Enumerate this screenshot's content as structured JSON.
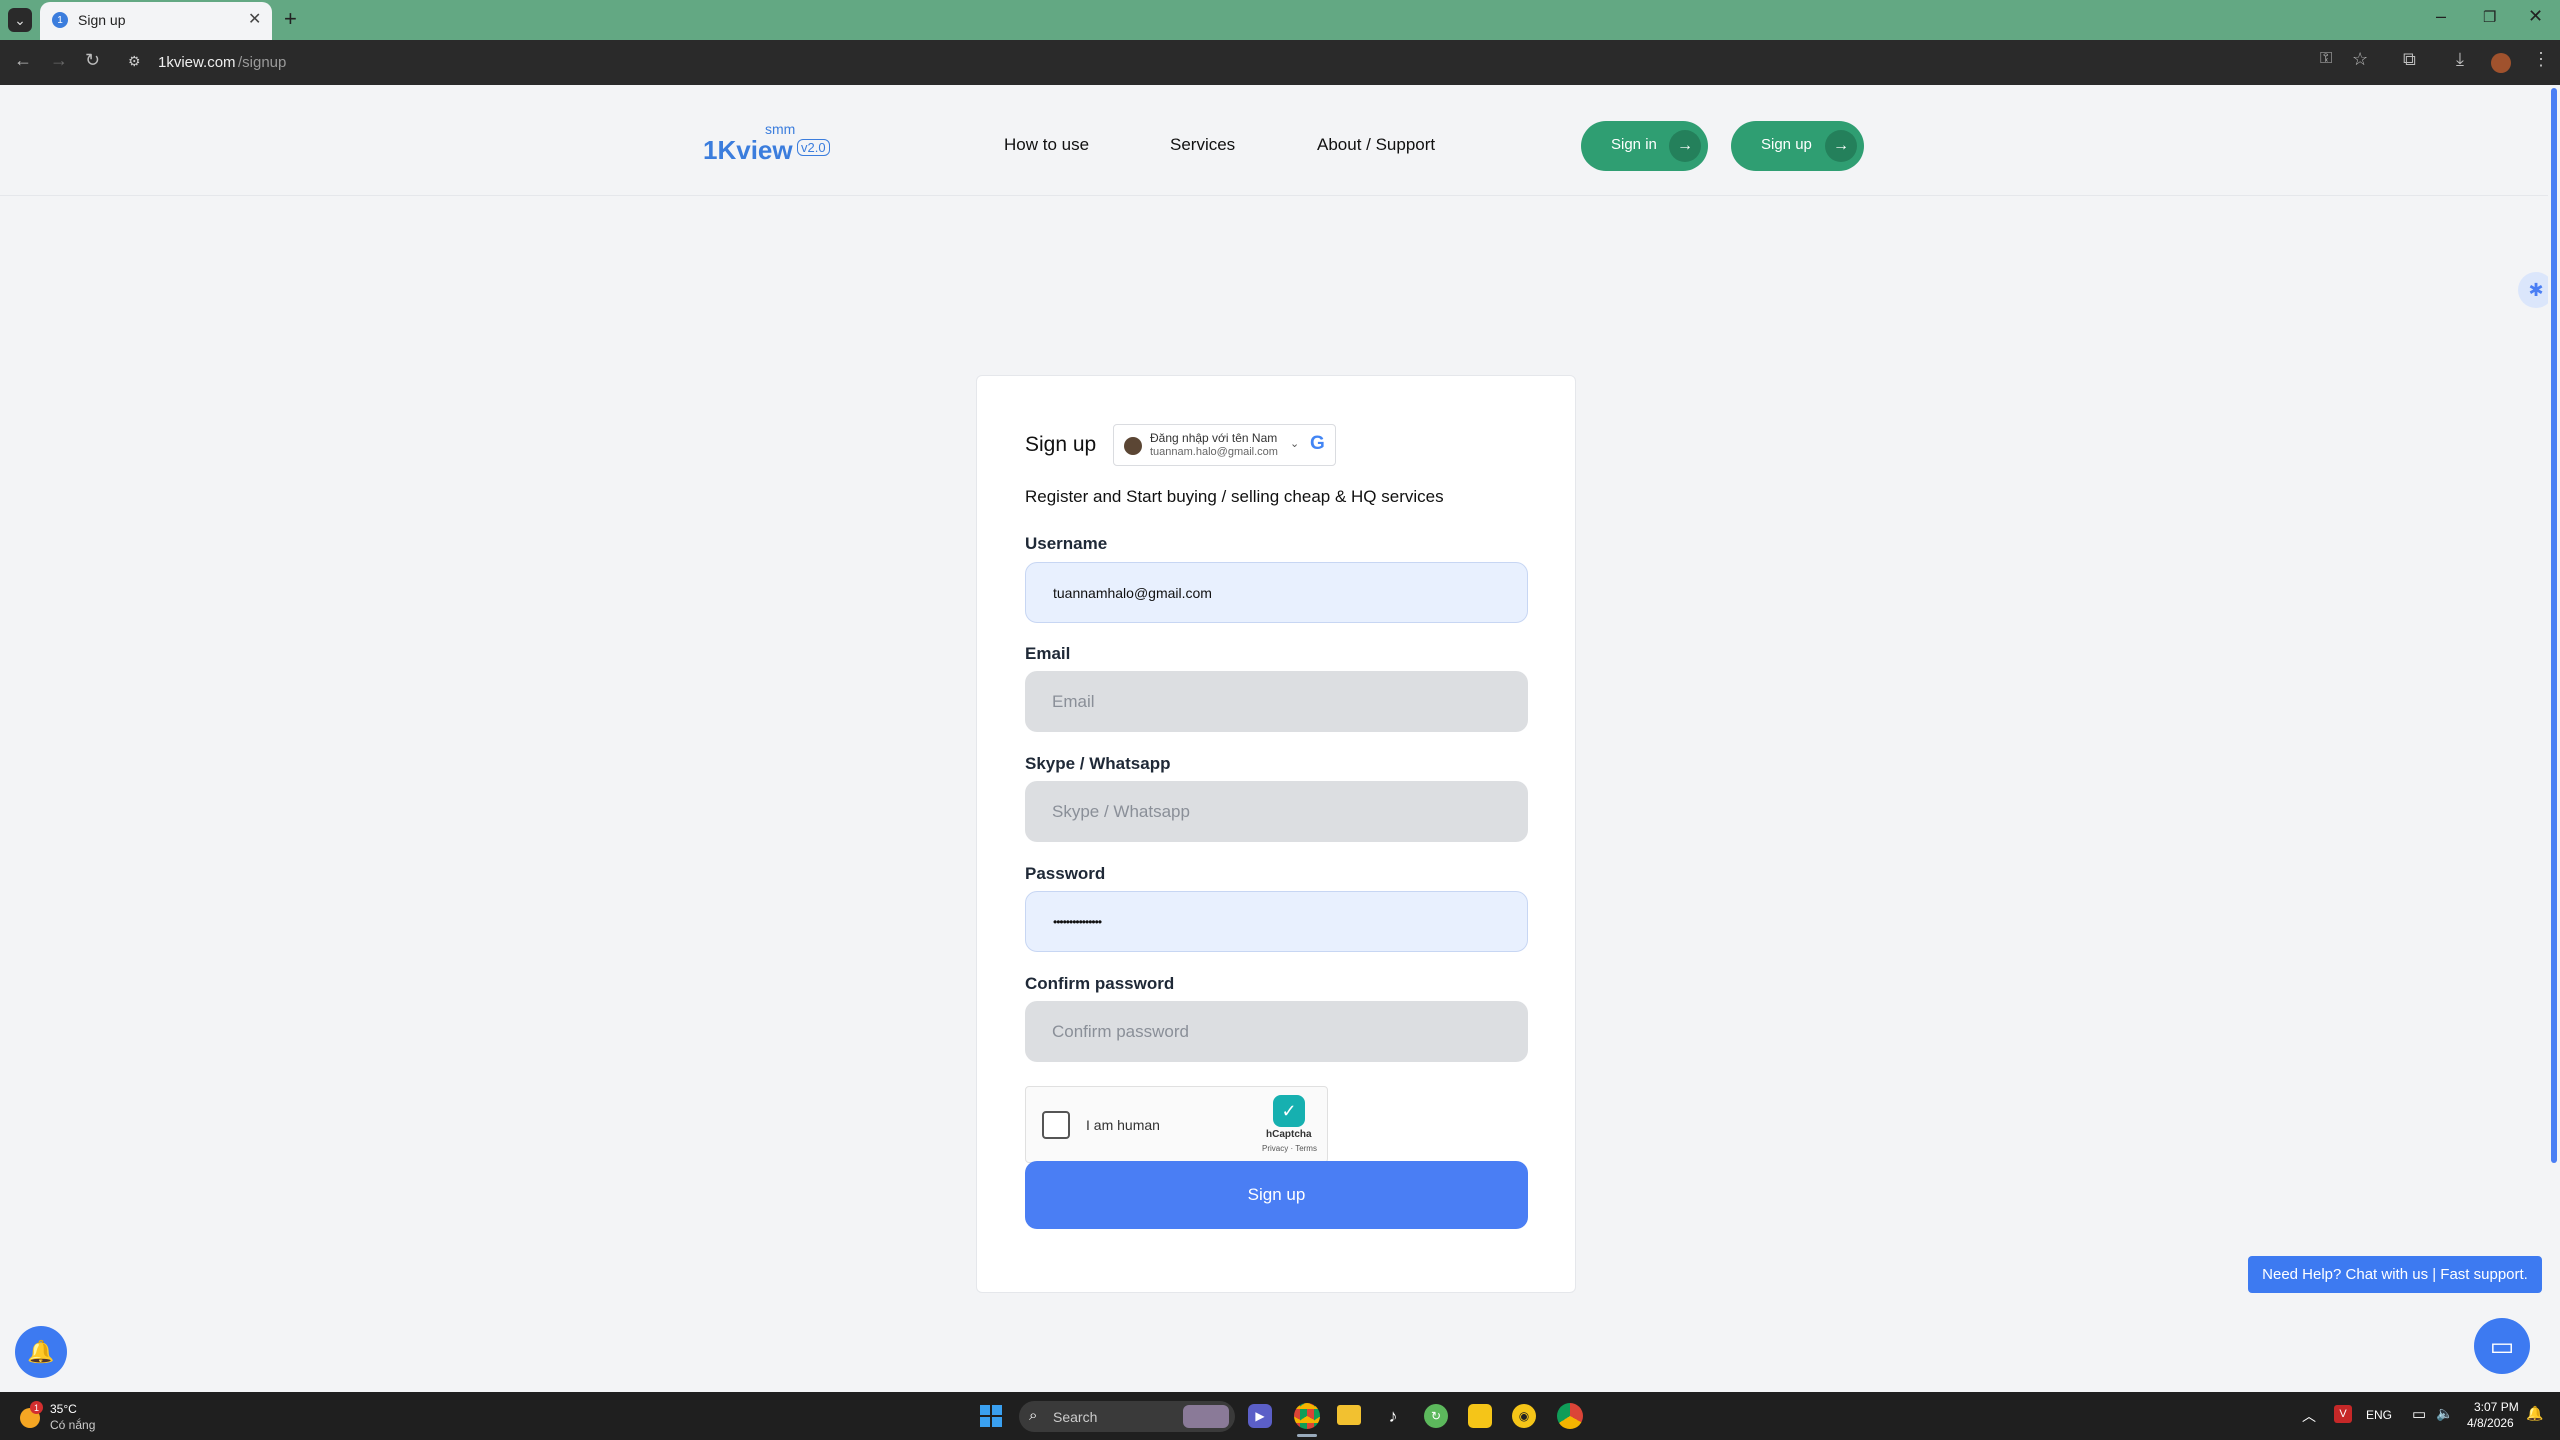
{
  "browser": {
    "tab_title": "Sign up",
    "url_domain": "1kview.com",
    "url_path": "/signup"
  },
  "site": {
    "logo": {
      "name": "1Kview",
      "sup": "smm",
      "version": "v2.0"
    },
    "nav": [
      "How to use",
      "Services",
      "About / Support"
    ],
    "sign_in": "Sign in",
    "sign_up": "Sign up"
  },
  "form": {
    "title": "Sign up",
    "google": {
      "line1": "Đăng nhập với tên Nam",
      "line2": "tuannam.halo@gmail.com"
    },
    "subtitle": "Register and Start buying / selling cheap & HQ services",
    "username": {
      "label": "Username",
      "value": "tuannamhalo@gmail.com"
    },
    "email": {
      "label": "Email",
      "placeholder": "Email"
    },
    "skype": {
      "label": "Skype / Whatsapp",
      "placeholder": "Skype / Whatsapp"
    },
    "password": {
      "label": "Password",
      "value": "•••••••••••••••"
    },
    "confirm": {
      "label": "Confirm password",
      "placeholder": "Confirm password"
    },
    "captcha": {
      "label": "I am human",
      "brand": "hCaptcha",
      "links": "Privacy · Terms"
    },
    "submit": "Sign up"
  },
  "help": {
    "text": "Need Help? Chat with us | Fast support."
  },
  "taskbar": {
    "weather_temp": "35°C",
    "weather_desc": "Có nắng",
    "weather_badge": "1",
    "search": "Search",
    "lang": "ENG",
    "time": "3:07 PM",
    "date": "4/8/2026"
  },
  "colors": {
    "brand_green": "#2f9e72",
    "primary_blue": "#4a7ef4",
    "logo_blue": "#3b7ddd"
  }
}
